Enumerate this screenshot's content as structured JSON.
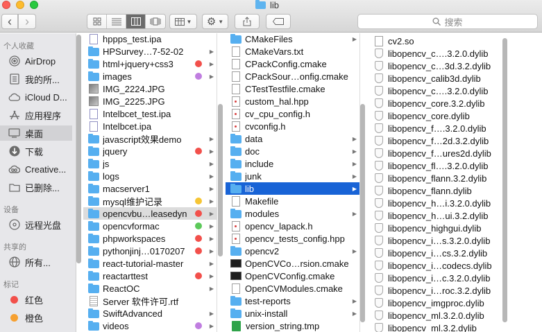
{
  "window": {
    "title": "lib"
  },
  "toolbar": {
    "back": "‹",
    "forward": "›",
    "search_placeholder": "搜索"
  },
  "sidebar": {
    "favorites_header": "个人收藏",
    "favorites": [
      {
        "label": "AirDrop",
        "icon": "airdrop-icon"
      },
      {
        "label": "我的所...",
        "icon": "documents-icon"
      },
      {
        "label": "iCloud D...",
        "icon": "cloud-icon"
      },
      {
        "label": "应用程序",
        "icon": "applications-icon"
      },
      {
        "label": "桌面",
        "icon": "desktop-icon",
        "selected": true
      },
      {
        "label": "下载",
        "icon": "download-icon"
      },
      {
        "label": "Creative...",
        "icon": "creative-cloud-icon"
      },
      {
        "label": "已删除...",
        "icon": "folder-icon"
      }
    ],
    "devices_header": "设备",
    "devices": [
      {
        "label": "远程光盘",
        "icon": "disc-icon"
      }
    ],
    "shared_header": "共享的",
    "shared": [
      {
        "label": "所有...",
        "icon": "network-icon"
      }
    ],
    "tags_header": "标记",
    "tags": [
      {
        "label": "红色",
        "color": "#f2504b"
      },
      {
        "label": "橙色",
        "color": "#f6a030"
      }
    ]
  },
  "column1": [
    {
      "name": "hppps_test.ipa",
      "icon": "ipa"
    },
    {
      "name": "HPSurvey…7-52-02",
      "icon": "folder",
      "arrow": true
    },
    {
      "name": "html+jquery+css3",
      "icon": "folder",
      "arrow": true,
      "tag": "#f2504b"
    },
    {
      "name": "images",
      "icon": "folder",
      "arrow": true,
      "tag": "#c07ee0"
    },
    {
      "name": "IMG_2224.JPG",
      "icon": "img"
    },
    {
      "name": "IMG_2225.JPG",
      "icon": "img"
    },
    {
      "name": "Intelbcet_test.ipa",
      "icon": "ipa"
    },
    {
      "name": "Intelbcet.ipa",
      "icon": "ipa"
    },
    {
      "name": "javascript效果demo",
      "icon": "folder",
      "arrow": true
    },
    {
      "name": "jquery",
      "icon": "folder",
      "arrow": true,
      "tag": "#f2504b"
    },
    {
      "name": "js",
      "icon": "folder",
      "arrow": true
    },
    {
      "name": "logs",
      "icon": "folder",
      "arrow": true
    },
    {
      "name": "macserver1",
      "icon": "folder",
      "arrow": true
    },
    {
      "name": "mysql维护记录",
      "icon": "folder",
      "arrow": true,
      "tag": "#f6c534"
    },
    {
      "name": "opencvbu…leasedyn",
      "icon": "folder",
      "arrow": true,
      "tag": "#f2504b",
      "highlight": true
    },
    {
      "name": "opencvformac",
      "icon": "folder",
      "arrow": true,
      "tag": "#5cc95a"
    },
    {
      "name": "phpworkspaces",
      "icon": "folder",
      "arrow": true,
      "tag": "#f2504b"
    },
    {
      "name": "pythonjinj…0170207",
      "icon": "folder",
      "arrow": true,
      "tag": "#f2504b"
    },
    {
      "name": "react-tutorial-master",
      "icon": "folder",
      "arrow": true
    },
    {
      "name": "reactarttest",
      "icon": "folder",
      "arrow": true,
      "tag": "#f2504b"
    },
    {
      "name": "ReactOC",
      "icon": "folder",
      "arrow": true
    },
    {
      "name": "Server 软件许可.rtf",
      "icon": "rtf"
    },
    {
      "name": "SwiftAdvanced",
      "icon": "folder",
      "arrow": true
    },
    {
      "name": "videos",
      "icon": "folder",
      "arrow": true,
      "tag": "#c07ee0"
    }
  ],
  "column2": [
    {
      "name": "CMakeFiles",
      "icon": "folder",
      "arrow": true
    },
    {
      "name": "CMakeVars.txt",
      "icon": "doc"
    },
    {
      "name": "CPackConfig.cmake",
      "icon": "doc"
    },
    {
      "name": "CPackSour…onfig.cmake",
      "icon": "doc"
    },
    {
      "name": "CTestTestfile.cmake",
      "icon": "doc"
    },
    {
      "name": "custom_hal.hpp",
      "icon": "hfile"
    },
    {
      "name": "cv_cpu_config.h",
      "icon": "hfile"
    },
    {
      "name": "cvconfig.h",
      "icon": "hfile"
    },
    {
      "name": "data",
      "icon": "folder",
      "arrow": true
    },
    {
      "name": "doc",
      "icon": "folder",
      "arrow": true
    },
    {
      "name": "include",
      "icon": "folder",
      "arrow": true
    },
    {
      "name": "junk",
      "icon": "folder",
      "arrow": true
    },
    {
      "name": "lib",
      "icon": "folder",
      "arrow": true,
      "selected": true
    },
    {
      "name": "Makefile",
      "icon": "doc"
    },
    {
      "name": "modules",
      "icon": "folder",
      "arrow": true
    },
    {
      "name": "opencv_lapack.h",
      "icon": "hfile"
    },
    {
      "name": "opencv_tests_config.hpp",
      "icon": "hfile"
    },
    {
      "name": "opencv2",
      "icon": "folder",
      "arrow": true
    },
    {
      "name": "OpenCVCo…rsion.cmake",
      "icon": "term"
    },
    {
      "name": "OpenCVConfig.cmake",
      "icon": "term"
    },
    {
      "name": "OpenCVModules.cmake",
      "icon": "doc"
    },
    {
      "name": "test-reports",
      "icon": "folder",
      "arrow": true
    },
    {
      "name": "unix-install",
      "icon": "folder",
      "arrow": true
    },
    {
      "name": "version_string.tmp",
      "icon": "tmp"
    }
  ],
  "column3": [
    {
      "name": "cv2.so",
      "icon": "doc"
    },
    {
      "name": "libopencv_c….3.2.0.dylib",
      "icon": "shield"
    },
    {
      "name": "libopencv_c…3d.3.2.dylib",
      "icon": "shield"
    },
    {
      "name": "libopencv_calib3d.dylib",
      "icon": "shield"
    },
    {
      "name": "libopencv_c….3.2.0.dylib",
      "icon": "shield"
    },
    {
      "name": "libopencv_core.3.2.dylib",
      "icon": "shield"
    },
    {
      "name": "libopencv_core.dylib",
      "icon": "shield"
    },
    {
      "name": "libopencv_f….3.2.0.dylib",
      "icon": "shield"
    },
    {
      "name": "libopencv_f…2d.3.2.dylib",
      "icon": "shield"
    },
    {
      "name": "libopencv_f…ures2d.dylib",
      "icon": "shield"
    },
    {
      "name": "libopencv_fl….3.2.0.dylib",
      "icon": "shield"
    },
    {
      "name": "libopencv_flann.3.2.dylib",
      "icon": "shield"
    },
    {
      "name": "libopencv_flann.dylib",
      "icon": "shield"
    },
    {
      "name": "libopencv_h…i.3.2.0.dylib",
      "icon": "shield"
    },
    {
      "name": "libopencv_h…ui.3.2.dylib",
      "icon": "shield"
    },
    {
      "name": "libopencv_highgui.dylib",
      "icon": "shield"
    },
    {
      "name": "libopencv_i…s.3.2.0.dylib",
      "icon": "shield"
    },
    {
      "name": "libopencv_i…cs.3.2.dylib",
      "icon": "shield"
    },
    {
      "name": "libopencv_i…codecs.dylib",
      "icon": "shield"
    },
    {
      "name": "libopencv_i…c.3.2.0.dylib",
      "icon": "shield"
    },
    {
      "name": "libopencv_i…roc.3.2.dylib",
      "icon": "shield"
    },
    {
      "name": "libopencv_imgproc.dylib",
      "icon": "shield"
    },
    {
      "name": "libopencv_ml.3.2.0.dylib",
      "icon": "shield"
    },
    {
      "name": "libopencv_ml.3.2.dylib",
      "icon": "shield"
    }
  ]
}
